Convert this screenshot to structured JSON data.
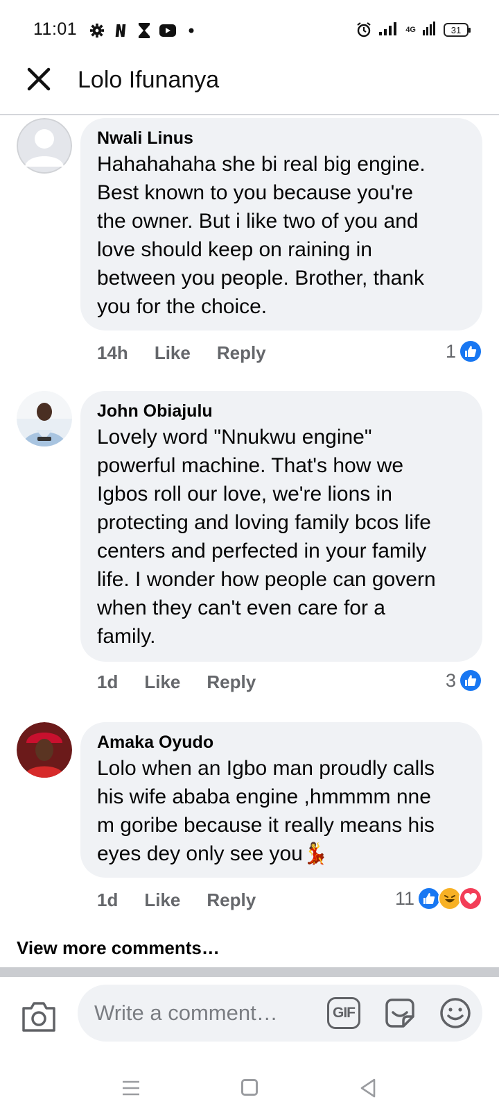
{
  "status_bar": {
    "time": "11:01",
    "left_icons": [
      "gear-icon",
      "netflix-n-icon",
      "hourglass-icon",
      "youtube-icon",
      "dot-icon"
    ],
    "network_label": "4G",
    "battery": "31"
  },
  "header": {
    "close_icon": "close-icon",
    "title": "Lolo Ifunanya"
  },
  "comments": [
    {
      "author": "Nwali Linus",
      "text": "Hahahahaha she bi real big engine.\nBest known to you because you're\nthe owner.  But i  like two of you and\nlove should keep on raining in\nbetween you people.  Brother, thank\nyou for the choice.",
      "time": "14h",
      "like_label": "Like",
      "reply_label": "Reply",
      "reaction_count": "1",
      "reactions": [
        "like"
      ]
    },
    {
      "author": "John Obiajulu",
      "text": "Lovely word \"Nnukwu engine\"\npowerful machine. That's how we\nIgbos roll our love, we're lions in\nprotecting and loving family bcos life\ncenters and perfected in your family\nlife. I wonder how people can govern\nwhen they can't even care for a\nfamily.",
      "time": "1d",
      "like_label": "Like",
      "reply_label": "Reply",
      "reaction_count": "3",
      "reactions": [
        "like"
      ]
    },
    {
      "author": "Amaka Oyudo",
      "text": "Lolo when an Igbo man proudly calls\nhis wife ababa engine ,hmmmm nne\nm goribe because it really means his\neyes dey only see you💃",
      "time": "1d",
      "like_label": "Like",
      "reply_label": "Reply",
      "reaction_count": "11",
      "reactions": [
        "like",
        "haha",
        "love"
      ]
    }
  ],
  "view_more": "View more comments…",
  "composer": {
    "placeholder": "Write a comment…",
    "gif_label": "GIF",
    "camera_icon": "camera-icon",
    "sticker_icon": "sticker-icon",
    "emoji_icon": "emoji-icon"
  },
  "colors": {
    "bubble": "#f0f2f5",
    "meta": "#65676b",
    "like_blue": "#1877f2",
    "haha_yellow": "#f7b125",
    "love_red": "#f33e58"
  }
}
